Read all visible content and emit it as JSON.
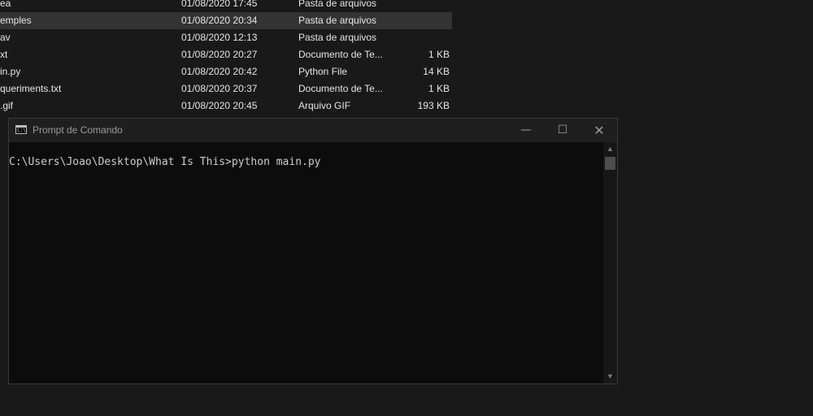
{
  "explorer": {
    "files": [
      {
        "name": "ea",
        "date": "01/08/2020 17:45",
        "type": "Pasta de arquivos",
        "size": ""
      },
      {
        "name": "emples",
        "date": "01/08/2020 20:34",
        "type": "Pasta de arquivos",
        "size": ""
      },
      {
        "name": "av",
        "date": "01/08/2020 12:13",
        "type": "Pasta de arquivos",
        "size": ""
      },
      {
        "name": "xt",
        "date": "01/08/2020 20:27",
        "type": "Documento de Te...",
        "size": "1 KB"
      },
      {
        "name": "in.py",
        "date": "01/08/2020 20:42",
        "type": "Python File",
        "size": "14 KB"
      },
      {
        "name": "queriments.txt",
        "date": "01/08/2020 20:37",
        "type": "Documento de Te...",
        "size": "1 KB"
      },
      {
        "name": ".gif",
        "date": "01/08/2020 20:45",
        "type": "Arquivo GIF",
        "size": "193 KB"
      }
    ]
  },
  "cmd": {
    "title": "Prompt de Comando",
    "icon_glyph": "C:\\",
    "minimize_glyph": "—",
    "maximize_glyph": "☐",
    "close_glyph": "✕",
    "prompt_line": "C:\\Users\\Joao\\Desktop\\What Is This>python main.py",
    "scroll_up_glyph": "▲",
    "scroll_down_glyph": "▼"
  }
}
